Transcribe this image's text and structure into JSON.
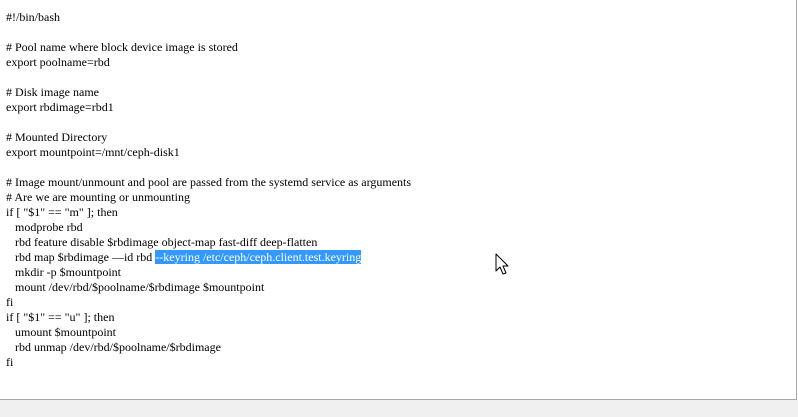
{
  "editor": {
    "lines": [
      "#!/bin/bash",
      "",
      "# Pool name where block device image is stored",
      "export poolname=rbd",
      "",
      "# Disk image name",
      "export rbdimage=rbd1",
      "",
      "# Mounted Directory",
      "export mountpoint=/mnt/ceph-disk1",
      "",
      "# Image mount/unmount and pool are passed from the systemd service as arguments",
      "# Are we are mounting or unmounting",
      "if [ \"$1\" == \"m\" ]; then",
      "   modprobe rbd",
      "   rbd feature disable $rbdimage object-map fast-diff deep-flatten",
      "   rbd map $rbdimage —id rbd ",
      "   mkdir -p $mountpoint",
      "   mount /dev/rbd/$poolname/$rbdimage $mountpoint",
      "fi",
      "if [ \"$1\" == \"u\" ]; then",
      "   umount $mountpoint",
      "   rbd unmap /dev/rbd/$poolname/$rbdimage",
      "fi"
    ],
    "selected_text": "--keyring /etc/ceph/ceph.client.test.keyring"
  },
  "cursor": {
    "icon": "arrow-pointer-icon"
  }
}
